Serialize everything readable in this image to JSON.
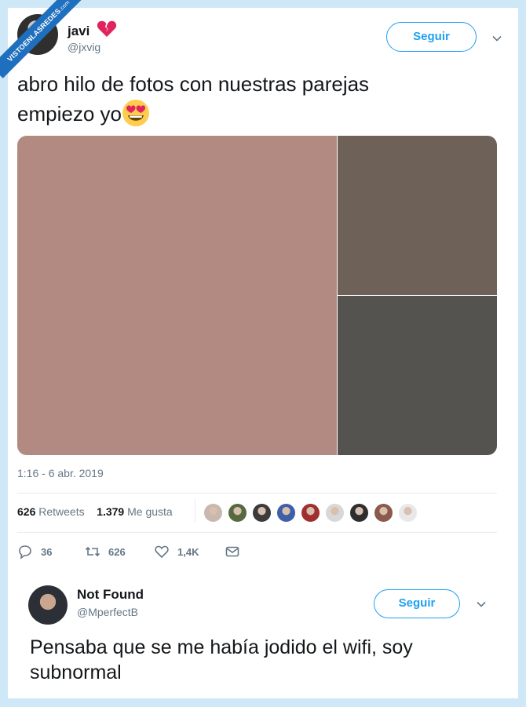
{
  "watermark": {
    "text": "VISTOENLASREDES",
    "suffix": ".com"
  },
  "tweet": {
    "author": {
      "name": "javi",
      "emoji": "broken-heart-icon",
      "handle": "@jxvig"
    },
    "follow_label": "Seguir",
    "text_line1": "abro hilo de fotos con nuestras parejas",
    "text_line2": "empiezo yo",
    "text_emoji": "heart-eyes-emoji-icon",
    "media": {
      "tiles": [
        "#b38a82",
        "#6e6258",
        "#545350"
      ]
    },
    "timestamp": "1:16 - 6 abr. 2019",
    "stats": {
      "retweets_count": "626",
      "retweets_label": "Retweets",
      "likes_count": "1.379",
      "likes_label": "Me gusta"
    },
    "liker_faces": [
      "#c9b8b0",
      "#556b3f",
      "#3b3b3b",
      "#3f5fa6",
      "#a03030",
      "#d8d8d8",
      "#2e2e2e",
      "#8a5a4a",
      "#e8e8e8"
    ],
    "actions": {
      "replies": "36",
      "retweets": "626",
      "likes": "1,4K"
    }
  },
  "reply": {
    "author": {
      "name": "Not Found",
      "handle": "@MperfectB"
    },
    "follow_label": "Seguir",
    "text_line1": "Pensaba que se me había jodido el wifi, soy",
    "text_line2": "subnormal"
  },
  "colors": {
    "accent": "#1da1f2",
    "muted": "#657786",
    "text": "#14171a"
  }
}
